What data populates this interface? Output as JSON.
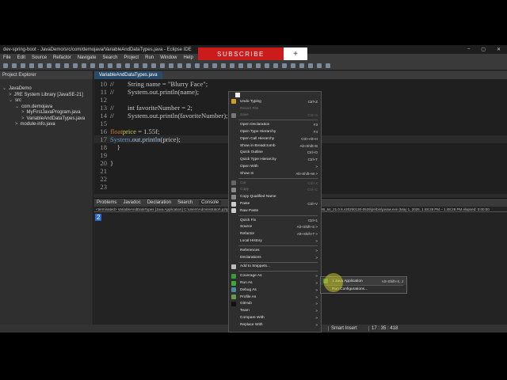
{
  "window": {
    "title": "dev-spring-boot - JavaDemo/src/com/demojava/VariableAndDataTypes.java - Eclipse IDE",
    "controls": [
      "–",
      "▢",
      "✕"
    ]
  },
  "banner": {
    "subscribe": "SUBSCRIBE",
    "plus": "+"
  },
  "menu": [
    "File",
    "Edit",
    "Source",
    "Refactor",
    "Navigate",
    "Search",
    "Project",
    "Run",
    "Window",
    "Help"
  ],
  "explorer": {
    "tab": "Project Explorer",
    "items": [
      {
        "label": "JavaDemo",
        "depth": 0,
        "arrow": "⌄"
      },
      {
        "label": "JRE System Library [JavaSE-21]",
        "depth": 1,
        "arrow": ">"
      },
      {
        "label": "src",
        "depth": 1,
        "arrow": "⌄"
      },
      {
        "label": "com.demojava",
        "depth": 2,
        "arrow": "⌄"
      },
      {
        "label": "MyFirstJavaProgram.java",
        "depth": 3,
        "arrow": ">"
      },
      {
        "label": "VariableAndDataTypes.java",
        "depth": 3,
        "arrow": ">"
      },
      {
        "label": "module-info.java",
        "depth": 2,
        "arrow": ">"
      }
    ]
  },
  "editor": {
    "tab": "VariableAndDataTypes.java",
    "lines": [
      {
        "n": "10",
        "text": "//        String name = \"Blurry Face\";"
      },
      {
        "n": "11",
        "text": "//        System.out.println(name);"
      },
      {
        "n": "12",
        "text": ""
      },
      {
        "n": "13",
        "text": "//        int favoriteNumber = 2;"
      },
      {
        "n": "14",
        "text": "//        System.out.println(favoriteNumber);"
      },
      {
        "n": "15",
        "text": ""
      },
      {
        "n": "16",
        "kw": "float",
        "var": "price",
        "rest": " = 1.55f;"
      },
      {
        "n": "17",
        "cls": "System",
        "mth": ".out.println",
        "rest": "(price);"
      },
      {
        "n": "18",
        "text": "    }"
      },
      {
        "n": "19",
        "text": ""
      },
      {
        "n": "20",
        "text": "}"
      },
      {
        "n": "21",
        "text": ""
      },
      {
        "n": "22",
        "text": ""
      },
      {
        "n": "23",
        "text": ""
      }
    ]
  },
  "console": {
    "tabs": [
      "Problems",
      "Javadoc",
      "Declaration",
      "Search",
      "Console"
    ],
    "path": "<terminated> VariableAndDataTypes [Java Application] C:\\Users\\Administrator\\.p2\\pool\\plugins\\org.eclipse.justj.openjdk.hotspot.jre.full.win32.x86_64_21.0.6.v20250130-0529\\jre\\bin\\javaw.exe (May 1, 2025, 1:48:28 PM – 1:48:28 PM elapsed: 0:00:00",
    "output": "2"
  },
  "status": {
    "mode": "Smart Insert",
    "position": "17 : 35 : 418"
  },
  "context_menu": {
    "groups": [
      [
        {
          "label": "Undo Typing",
          "key": "Ctrl+Z",
          "icon": "undo"
        },
        {
          "label": "Revert File",
          "key": "",
          "disabled": true
        },
        {
          "label": "Save",
          "key": "Ctrl+S",
          "disabled": true,
          "icon": "save"
        }
      ],
      [
        {
          "label": "Open Declaration",
          "key": "F3"
        },
        {
          "label": "Open Type Hierarchy",
          "key": "F4"
        },
        {
          "label": "Open Call Hierarchy",
          "key": "Ctrl+Alt+H"
        },
        {
          "label": "Show in Breadcrumb",
          "key": "Alt+Shift+B"
        },
        {
          "label": "Quick Outline",
          "key": "Ctrl+O"
        },
        {
          "label": "Quick Type Hierarchy",
          "key": "Ctrl+T"
        },
        {
          "label": "Open With",
          "key": ">"
        },
        {
          "label": "Show In",
          "key": "Alt+Shift+W >"
        }
      ],
      [
        {
          "label": "Cut",
          "key": "Ctrl+X",
          "disabled": true,
          "icon": "cut"
        },
        {
          "label": "Copy",
          "key": "Ctrl+C",
          "disabled": true,
          "icon": "copy"
        },
        {
          "label": "Copy Qualified Name",
          "key": "",
          "icon": "copy"
        },
        {
          "label": "Paste",
          "key": "Ctrl+V",
          "icon": "paste"
        },
        {
          "label": "Raw Paste",
          "key": "",
          "icon": "paste"
        }
      ],
      [
        {
          "label": "Quick Fix",
          "key": "Ctrl+1"
        },
        {
          "label": "Source",
          "key": "Alt+Shift+S >"
        },
        {
          "label": "Refactor",
          "key": "Alt+Shift+T >"
        },
        {
          "label": "Local History",
          "key": ">"
        }
      ],
      [
        {
          "label": "References",
          "key": ">"
        },
        {
          "label": "Declarations",
          "key": ">"
        }
      ],
      [
        {
          "label": "Add to Snippets...",
          "key": "",
          "icon": "snippet"
        }
      ],
      [
        {
          "label": "Coverage As",
          "key": ">",
          "icon": "coverage"
        },
        {
          "label": "Run As",
          "key": ">",
          "icon": "run"
        },
        {
          "label": "Debug As",
          "key": ">",
          "icon": "debug"
        },
        {
          "label": "Profile As",
          "key": ">",
          "icon": "profile"
        },
        {
          "label": "GitHub",
          "key": ">",
          "icon": "github"
        },
        {
          "label": "Team",
          "key": ">"
        },
        {
          "label": "Compare With",
          "key": ">"
        },
        {
          "label": "Replace With",
          "key": ">"
        }
      ]
    ]
  },
  "submenu": {
    "items": [
      {
        "label": "1 Java Application",
        "key": "Alt+Shift+X, J"
      },
      {
        "label": "Run Configurations...",
        "key": ""
      }
    ]
  },
  "colors": {
    "subscribe": "#cc1b1b",
    "selection": "#2a4a6a"
  }
}
